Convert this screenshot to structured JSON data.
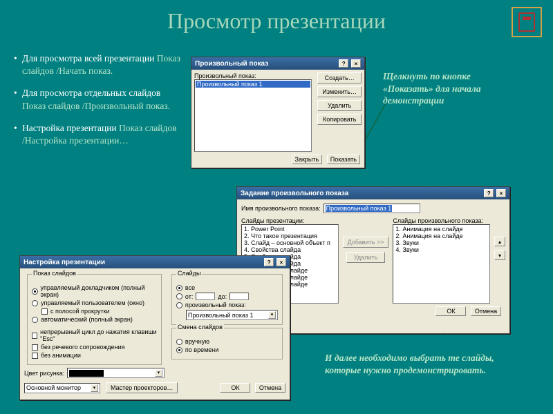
{
  "title": "Просмотр презентации",
  "bullets": [
    {
      "pre": "Для просмотра всей презентации ",
      "hl": "Показ слайдов /Начать показ."
    },
    {
      "pre": "Для просмотра отдельных слайдов ",
      "hl": "Показ слайдов /Произвольный показ."
    },
    {
      "pre": "Настройка презентации ",
      "hl": "Показ слайдов /Настройка презентации…",
      "noBullet": true
    }
  ],
  "caption_right": "Щелкнуть по кнопке «Показать» для начала демонстрации",
  "caption_bottom": "И далее необходимо выбрать те слайды, которые нужно продемонстрировать.",
  "dlg1": {
    "title": "Произвольный показ",
    "label": "Произвольный показ:",
    "item": "Произвольный показ 1",
    "buttons": {
      "create": "Создать…",
      "edit": "Изменить…",
      "delete": "Удалить",
      "copy": "Копировать",
      "close": "Закрыть",
      "show": "Показать"
    }
  },
  "dlg2": {
    "title": "Задание произвольного показа",
    "name_label": "Имя произвольного показа:",
    "name_value": "Произвольный показ 1",
    "left_label": "Слайды презентации:",
    "right_label": "Слайды произвольного показа:",
    "left_items": [
      "1. Power Point",
      "2. Что такое презентация",
      "3. Слайд – основной объект п",
      "4. Свойства слайда",
      "5. Свойства слайда",
      "6. Свойства слайда",
      "7. Объекты на слайде",
      "8. Объекты на слайде",
      "9. Объекты на слайде"
    ],
    "right_items": [
      "1. Анимация на слайде",
      "2. Анимация на слайде",
      "3. Звуки",
      "4. Звуки"
    ],
    "add": "Добавить >>",
    "remove": "Удалить",
    "ok": "ОК",
    "cancel": "Отмена"
  },
  "dlg3": {
    "title": "Настройка презентации",
    "g_show": "Показ слайдов",
    "r_show": [
      "управляемый докладчиком (полный экран)",
      "управляемый пользователем (окно)",
      "автоматический (полный экран)"
    ],
    "chk": [
      "непрерывный цикл до нажатия клавиши \"Esc\"",
      "без речевого сопровождения",
      "без анимации"
    ],
    "scrollbar": "с полосой прокрутки",
    "g_slides": "Слайды",
    "r_all": "все",
    "r_from": "от:",
    "r_to": "до:",
    "r_custom": "произвольный показ:",
    "dd_custom": "Произвольный показ 1",
    "g_change": "Смена слайдов",
    "r_manual": "вручную",
    "r_time": "по времени",
    "pen": "Цвет рисунка:",
    "monitor": "Основной монитор",
    "master": "Мастер проекторов…",
    "ok": "ОК",
    "cancel": "Отмена"
  }
}
